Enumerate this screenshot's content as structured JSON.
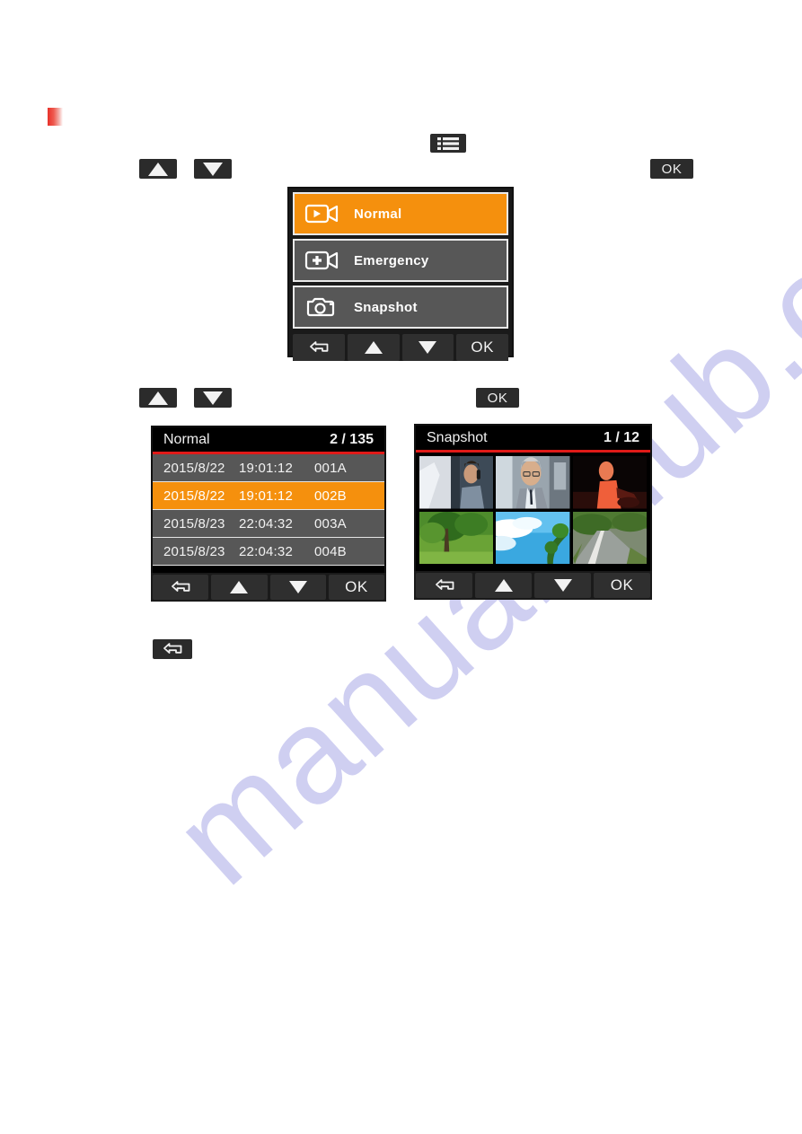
{
  "watermark": {
    "text": "manualshub.com"
  },
  "hardware_keys": {
    "row1": [
      {
        "name": "up-key",
        "icon": "triangle-up-icon",
        "label": ""
      },
      {
        "name": "down-key",
        "icon": "triangle-down-icon",
        "label": ""
      }
    ],
    "menu_key": {
      "icon": "list-menu-icon",
      "label": ""
    },
    "ok_key_1": {
      "label": "OK"
    },
    "row2": [
      {
        "name": "up-key",
        "icon": "triangle-up-icon",
        "label": ""
      },
      {
        "name": "down-key",
        "icon": "triangle-down-icon",
        "label": ""
      }
    ],
    "ok_key_2": {
      "label": "OK"
    },
    "back_key": {
      "icon": "back-arrow-icon",
      "label": ""
    }
  },
  "mode_menu": {
    "items": [
      {
        "label": "Normal",
        "icon": "video-play-icon",
        "selected": true
      },
      {
        "label": "Emergency",
        "icon": "video-plus-icon",
        "selected": false
      },
      {
        "label": "Snapshot",
        "icon": "photo-camera-icon",
        "selected": false
      }
    ],
    "softkeys": [
      {
        "name": "back",
        "icon": "back-arrow-icon",
        "label": ""
      },
      {
        "name": "up",
        "icon": "triangle-up-icon",
        "label": ""
      },
      {
        "name": "down",
        "icon": "triangle-down-icon",
        "label": ""
      },
      {
        "name": "ok",
        "icon": "",
        "label": "OK"
      }
    ]
  },
  "file_list": {
    "title": "Normal",
    "counter": "2 / 135",
    "accent_color": "#e01a18",
    "highlight_color": "#f5900d",
    "rows": [
      {
        "date": "2015/8/22",
        "time": "19:01:12",
        "id": "001A",
        "selected": false
      },
      {
        "date": "2015/8/22",
        "time": "19:01:12",
        "id": "002B",
        "selected": true
      },
      {
        "date": "2015/8/23",
        "time": "22:04:32",
        "id": "003A",
        "selected": false
      },
      {
        "date": "2015/8/23",
        "time": "22:04:32",
        "id": "004B",
        "selected": false
      }
    ],
    "softkeys": [
      {
        "name": "back",
        "icon": "back-arrow-icon",
        "label": ""
      },
      {
        "name": "up",
        "icon": "triangle-up-icon",
        "label": ""
      },
      {
        "name": "down",
        "icon": "triangle-down-icon",
        "label": ""
      },
      {
        "name": "ok",
        "icon": "",
        "label": "OK"
      }
    ]
  },
  "snapshot_grid": {
    "title": "Snapshot",
    "counter": "1 / 12",
    "accent_color": "#e01a18",
    "thumbnails": [
      {
        "name": "thumb-man-phone-in-car"
      },
      {
        "name": "thumb-older-man-in-car"
      },
      {
        "name": "thumb-night-driver"
      },
      {
        "name": "thumb-green-tree"
      },
      {
        "name": "thumb-blue-sky-clouds"
      },
      {
        "name": "thumb-country-road"
      }
    ],
    "softkeys": [
      {
        "name": "back",
        "icon": "back-arrow-icon",
        "label": ""
      },
      {
        "name": "up",
        "icon": "triangle-up-icon",
        "label": ""
      },
      {
        "name": "down",
        "icon": "triangle-down-icon",
        "label": ""
      },
      {
        "name": "ok",
        "icon": "",
        "label": "OK"
      }
    ]
  }
}
